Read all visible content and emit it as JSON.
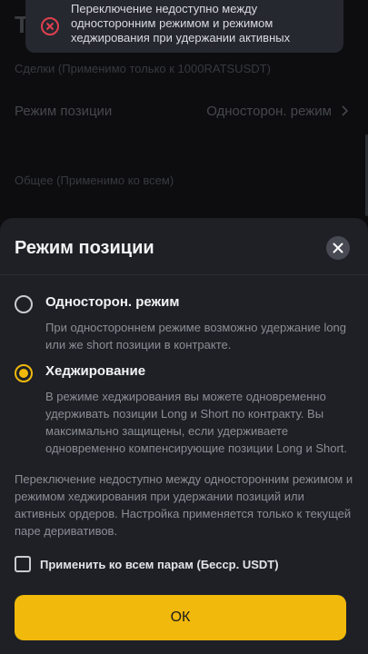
{
  "background": {
    "title": "T",
    "trades_section": "Сделки (Применимо только к 1000RATSUSDT)",
    "position_mode_row": {
      "label": "Режим позиции",
      "value": "Односторон. режим"
    },
    "general_section": "Общее (Применимо ко всем)"
  },
  "toast": {
    "icon": "error-circle-x-icon",
    "message": "Переключение недоступно между односторонним режимом и режимом хеджирования при удержании активных"
  },
  "sheet": {
    "title": "Режим позиции",
    "options": [
      {
        "label": "Односторон. режим",
        "description": "При одностороннем режиме возможно удержание long или же short позиции в контракте.",
        "selected": false
      },
      {
        "label": "Хеджирование",
        "description": "В режиме хеджирования вы можете одновременно удерживать позиции Long и Short по контракту. Вы максимально защищены, если удерживаете одновременно компенсирующие позиции Long и Short.",
        "selected": true
      }
    ],
    "note": "Переключение недоступно между односторонним режимом и режимом хеджирования при удержании позиций или активных ордеров. Настройка применяется только к текущей паре деривативов.",
    "apply_all_label": "Применить ко всем парам (Бесср. USDT)",
    "ok_label": "ОК"
  },
  "colors": {
    "accent": "#f0b90b",
    "error": "#e0404e",
    "sheet_bg": "#1e2026"
  }
}
